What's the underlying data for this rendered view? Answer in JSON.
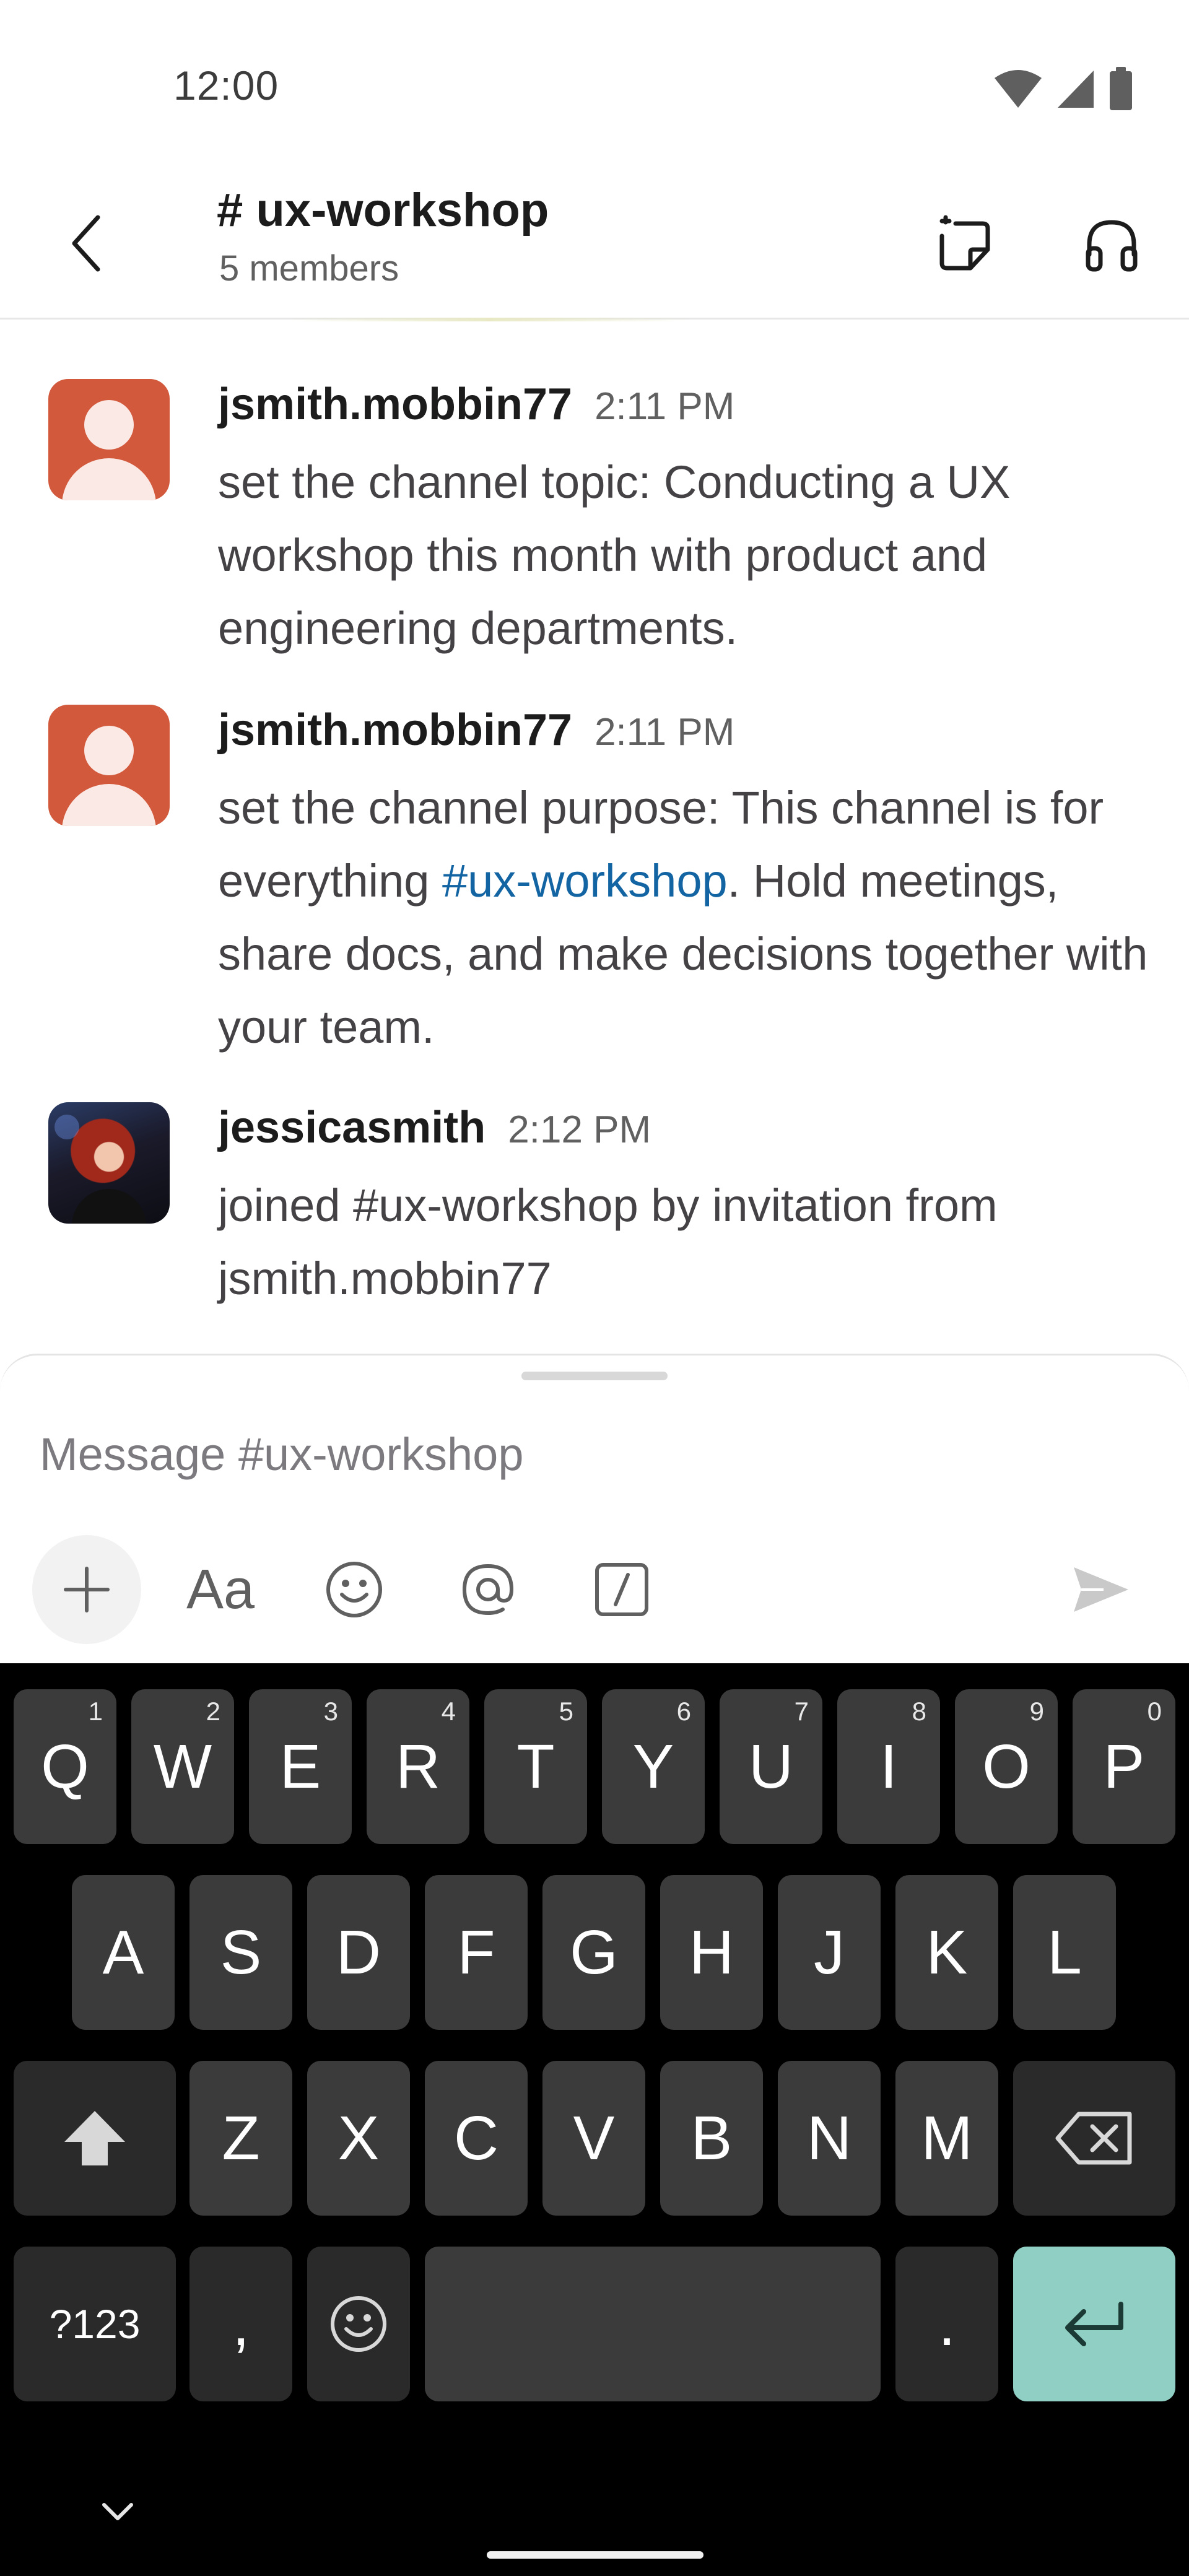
{
  "status_bar": {
    "time": "12:00",
    "icons": [
      "wifi-icon",
      "cellular-signal-icon",
      "battery-icon"
    ]
  },
  "header": {
    "channel_name": "# ux-workshop",
    "member_count": "5 members",
    "icons": [
      "back-arrow-icon",
      "canvas-icon",
      "huddle-headphones-icon"
    ]
  },
  "messages": [
    {
      "author": "jsmith.mobbin77",
      "time": "2:11 PM",
      "text": "set the channel topic: Conducting a UX workshop this month with product and engineering departments.",
      "avatar": "default-user-avatar"
    },
    {
      "author": "jsmith.mobbin77",
      "time": "2:11 PM",
      "text_before_link": "set the channel purpose: This channel is for everything ",
      "link": "#ux-workshop",
      "text_after_link": ". Hold meetings, share docs, and make decisions together with your team.",
      "avatar": "default-user-avatar"
    },
    {
      "author": "jessicasmith",
      "time": "2:12 PM",
      "text": "joined #ux-workshop by invitation from jsmith.mobbin77",
      "avatar": "photo-avatar"
    }
  ],
  "composer": {
    "placeholder": "Message #ux-workshop",
    "format_label": "Aa",
    "icons": [
      "plus-icon",
      "text-format-icon",
      "emoji-icon",
      "mention-icon",
      "slash-command-icon",
      "send-icon"
    ]
  },
  "keyboard": {
    "row1": [
      {
        "key": "Q",
        "hint": "1"
      },
      {
        "key": "W",
        "hint": "2"
      },
      {
        "key": "E",
        "hint": "3"
      },
      {
        "key": "R",
        "hint": "4"
      },
      {
        "key": "T",
        "hint": "5"
      },
      {
        "key": "Y",
        "hint": "6"
      },
      {
        "key": "U",
        "hint": "7"
      },
      {
        "key": "I",
        "hint": "8"
      },
      {
        "key": "O",
        "hint": "9"
      },
      {
        "key": "P",
        "hint": "0"
      }
    ],
    "row2": [
      "A",
      "S",
      "D",
      "F",
      "G",
      "H",
      "J",
      "K",
      "L"
    ],
    "row3": [
      "Z",
      "X",
      "C",
      "V",
      "B",
      "N",
      "M"
    ],
    "symbols_label": "?123",
    "comma": ",",
    "period": ".",
    "colors": {
      "key": "#3b3b3b",
      "special_key": "#2a2a2a",
      "enter": "#8fcfc4"
    }
  },
  "colors": {
    "link": "#1264a3",
    "avatar_default": "#d2593c",
    "text_primary": "#1d1c1d",
    "text_secondary": "#616061"
  }
}
